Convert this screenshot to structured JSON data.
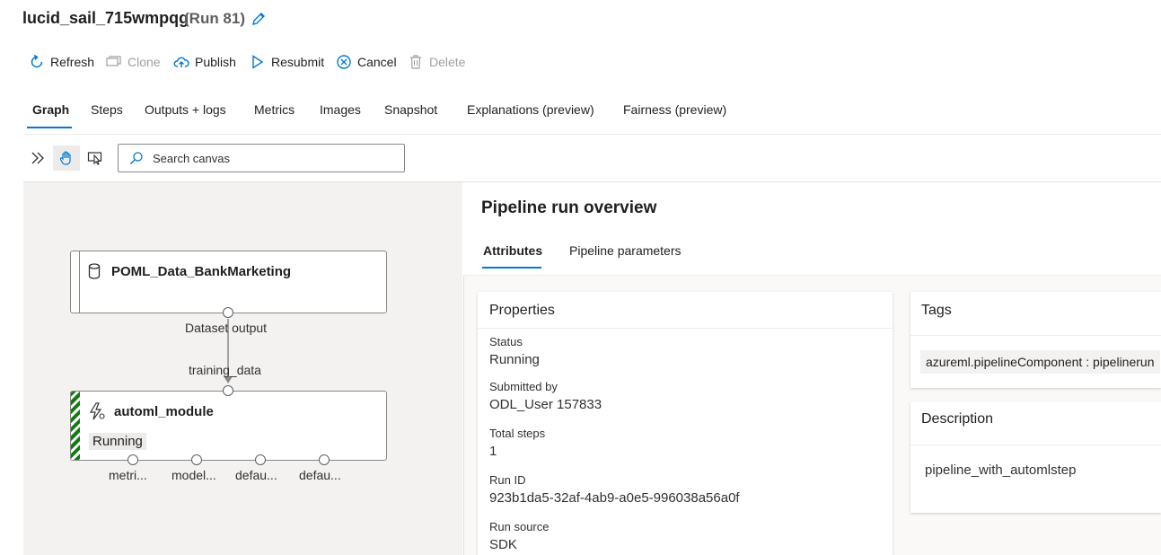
{
  "header": {
    "run_name": "lucid_sail_715wmpqg",
    "run_number": "(Run 81)"
  },
  "toolbar": {
    "refresh": "Refresh",
    "clone": "Clone",
    "publish": "Publish",
    "resubmit": "Resubmit",
    "cancel": "Cancel",
    "delete": "Delete"
  },
  "tabs": [
    "Graph",
    "Steps",
    "Outputs + logs",
    "Metrics",
    "Images",
    "Snapshot",
    "Explanations (preview)",
    "Fairness (preview)"
  ],
  "canvas_toolbar": {
    "search_placeholder": "Search canvas"
  },
  "graph": {
    "dataset_node": {
      "title": "POML_Data_BankMarketing",
      "output_label": "Dataset output"
    },
    "edge_label": "training_data",
    "automl_node": {
      "title": "automl_module",
      "status": "Running",
      "outputs": [
        "metri...",
        "model...",
        "defau...",
        "defau..."
      ]
    }
  },
  "panel": {
    "title": "Pipeline run overview",
    "tabs": [
      "Attributes",
      "Pipeline parameters"
    ],
    "properties": {
      "heading": "Properties",
      "status_label": "Status",
      "status_value": "Running",
      "submitted_label": "Submitted by",
      "submitted_value": "ODL_User 157833",
      "steps_label": "Total steps",
      "steps_value": "1",
      "runid_label": "Run ID",
      "runid_value": "923b1da5-32af-4ab9-a0e5-996038a56a0f",
      "source_label": "Run source",
      "source_value": "SDK"
    },
    "tags": {
      "heading": "Tags",
      "items": [
        "azureml.pipelineComponent : pipelinerun"
      ]
    },
    "description": {
      "heading": "Description",
      "text": "pipeline_with_automlstep"
    }
  },
  "colors": {
    "accent": "#0078d4",
    "running_stripe": "#107c10"
  }
}
